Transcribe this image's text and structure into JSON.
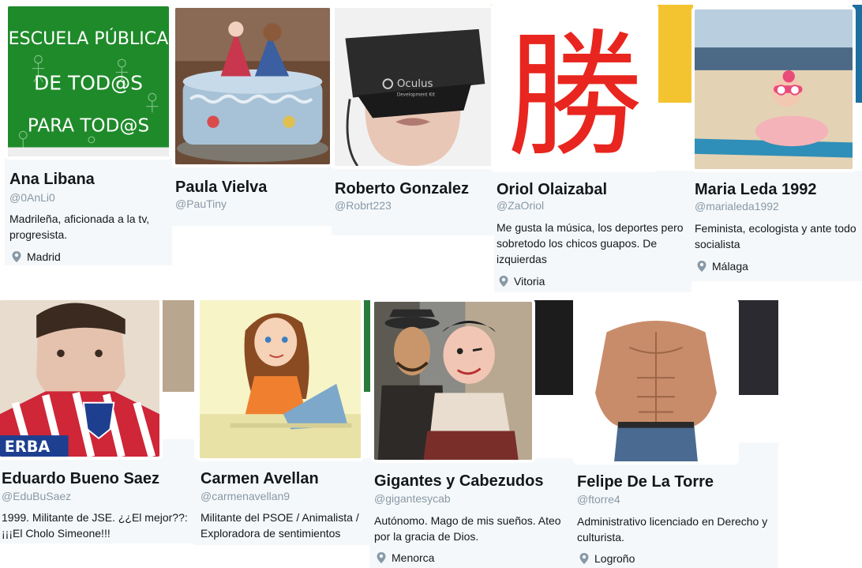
{
  "colors": {
    "card_bg": "#f5f8fa",
    "name": "#14171a",
    "handle": "#8899a6"
  },
  "profiles": [
    {
      "name": "Ana Libana",
      "handle": "@0AnLi0",
      "bio": "Madrileña, aficionada a la tv, progresista.",
      "location": "Madrid",
      "avatar_text": [
        "ESCUELA PÚBLICA",
        "DE TOD@S",
        "PARA TOD@S"
      ],
      "avatar_icon": "green-chalkboard-sign"
    },
    {
      "name": "Paula Vielva",
      "handle": "@PauTiny",
      "bio": "",
      "location": "",
      "avatar_icon": "decorated-cake"
    },
    {
      "name": "Roberto Gonzalez",
      "handle": "@Robrt223",
      "bio": "",
      "location": "",
      "avatar_icon": "vr-headset",
      "avatar_text": [
        "Oculus",
        "Development Kit"
      ]
    },
    {
      "name": "Oriol Olaizabal",
      "handle": "@ZaOriol",
      "bio": "Me gusta la música, los deportes pero sobretodo los chicos guapos. De izquierdas",
      "location": "Vitoria",
      "avatar_text": [
        "勝"
      ],
      "avatar_icon": "kanji-glyph"
    },
    {
      "name": "Maria Leda 1992",
      "handle": "@marialeda1992",
      "bio": "Feminista, ecologista y ante todo socialista",
      "location": "Málaga",
      "avatar_icon": "baby-on-beach"
    },
    {
      "name": "Eduardo Bueno Saez",
      "handle": "@EduBuSaez",
      "bio": "1999. Militante de JSE. ¿¿El mejor??: ¡¡¡El Cholo Simeone!!!",
      "location": "",
      "avatar_text": [
        "ERBA"
      ],
      "avatar_icon": "football-shirt-selfie"
    },
    {
      "name": "Carmen Avellan",
      "handle": "@carmenavellan9",
      "bio": "Militante del PSOE / Animalista / Exploradora de sentimientos",
      "location": "",
      "avatar_icon": "cartoon-woman-laptop"
    },
    {
      "name": "Gigantes y Cabezudos",
      "handle": "@gigantesycab",
      "bio": "Autónomo. Mago de mis sueños. Ateo por la gracia de Dios.",
      "location": "Menorca",
      "avatar_icon": "festival-giants"
    },
    {
      "name": "Felipe De La Torre",
      "handle": "@ftorre4",
      "bio": "Administrativo licenciado en Derecho y culturista.",
      "location": "Logroño",
      "avatar_icon": "muscular-torso"
    }
  ]
}
